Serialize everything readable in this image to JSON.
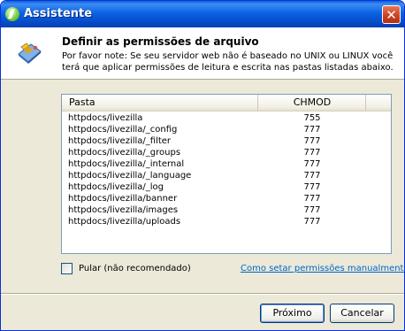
{
  "window": {
    "title": "Assistente",
    "close": "✕"
  },
  "header": {
    "title": "Definir as permissões de arquivo",
    "description": "Por favor note: Se seu servidor web não é baseado no UNIX ou LINUX você terá que aplicar permissões de leitura e escrita nas pastas listadas abaixo."
  },
  "list": {
    "columns": [
      "Pasta",
      "CHMOD"
    ],
    "rows": [
      [
        "httpdocs/livezilla",
        "755"
      ],
      [
        "httpdocs/livezilla/_config",
        "777"
      ],
      [
        "httpdocs/livezilla/_filter",
        "777"
      ],
      [
        "httpdocs/livezilla/_groups",
        "777"
      ],
      [
        "httpdocs/livezilla/_internal",
        "777"
      ],
      [
        "httpdocs/livezilla/_language",
        "777"
      ],
      [
        "httpdocs/livezilla/_log",
        "777"
      ],
      [
        "httpdocs/livezilla/banner",
        "777"
      ],
      [
        "httpdocs/livezilla/images",
        "777"
      ],
      [
        "httpdocs/livezilla/uploads",
        "777"
      ]
    ]
  },
  "skip": {
    "label": "Pular (não recomendado)",
    "checked": false
  },
  "manual_link": "Como setar permissões manualmente",
  "buttons": {
    "next": "Próximo",
    "cancel": "Cancelar"
  }
}
